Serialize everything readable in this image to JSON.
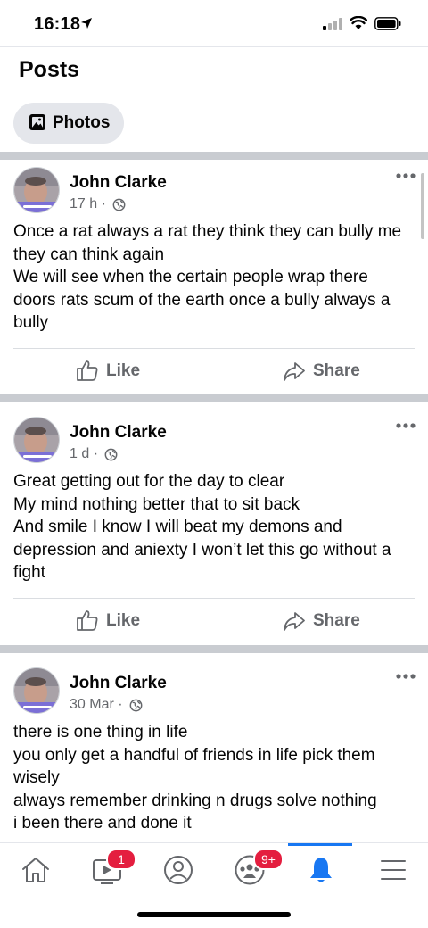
{
  "status": {
    "time": "16:18"
  },
  "section": {
    "title": "Posts"
  },
  "filters": {
    "photos_label": "Photos"
  },
  "colors": {
    "accent": "#1877f2",
    "badge": "#e41e3f",
    "muted": "#65676b",
    "separator": "#c9ccd1"
  },
  "posts": [
    {
      "author": "John Clarke",
      "time": "17 h",
      "dot": "·",
      "text": "Once a rat always a rat they think they can bully me they can think again\nWe will see when the certain people wrap there doors rats scum of the earth once a bully always a bully",
      "like_label": "Like",
      "share_label": "Share"
    },
    {
      "author": "John Clarke",
      "time": "1 d",
      "dot": "·",
      "text": "Great getting out for the day to clear\nMy mind nothing better that to sit back\nAnd smile I know I will beat my demons and depression and aniexty I won’t let this go without a fight",
      "like_label": "Like",
      "share_label": "Share"
    },
    {
      "author": "John Clarke",
      "time": "30 Mar",
      "dot": "·",
      "text": "there is one thing in life\nyou only get a handful of friends in life pick them wisely\nalways remember drinking n drugs solve nothing\ni been there and done it",
      "like_label": "",
      "share_label": ""
    }
  ],
  "tabbar": {
    "active": "notifications",
    "watch_badge": "1",
    "groups_badge": "9+"
  },
  "icons": [
    "location-arrow-icon",
    "signal-icon",
    "wifi-icon",
    "battery-icon",
    "photo-icon",
    "globe-icon",
    "more-icon",
    "like-icon",
    "share-icon",
    "home-icon",
    "watch-icon",
    "profile-icon",
    "groups-icon",
    "bell-icon",
    "menu-icon"
  ]
}
